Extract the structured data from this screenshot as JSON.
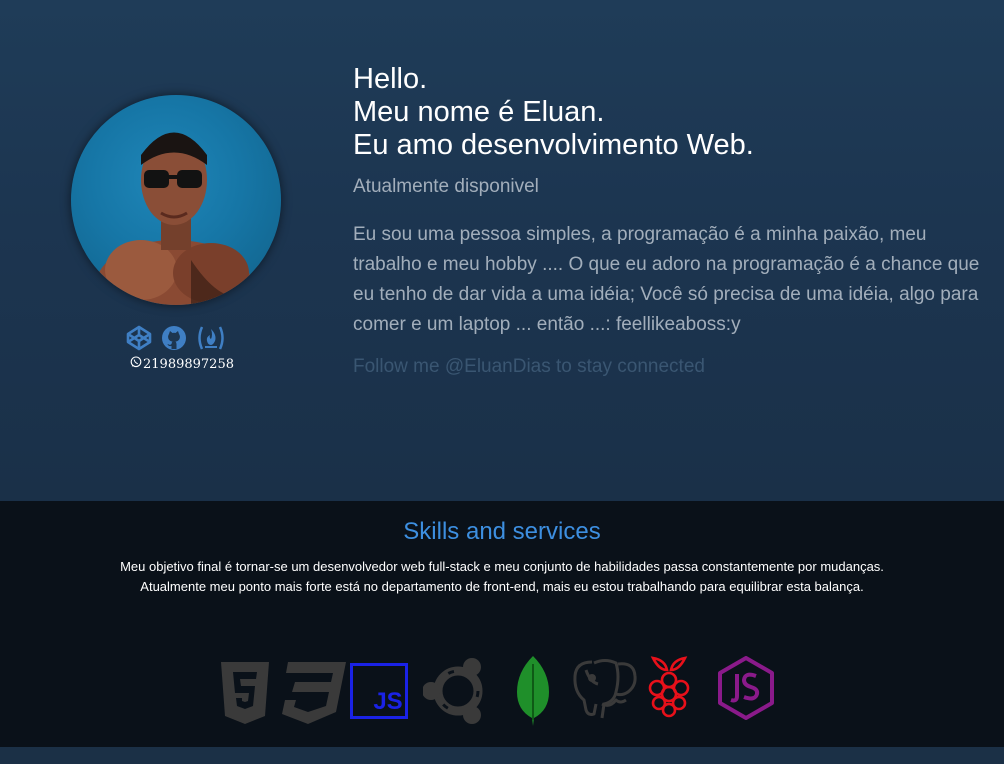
{
  "profile": {
    "avatar_alt": "profile photo",
    "phone": "21989897258",
    "social_icons": [
      "codepen-icon",
      "github-icon",
      "freecodecamp-icon"
    ],
    "whatsapp_icon": "whatsapp-icon"
  },
  "intro": {
    "line1": "Hello.",
    "line2": "Meu nome é Eluan.",
    "line3": "Eu amo desenvolvimento Web.",
    "status": "Atualmente disponivel",
    "bio": "Eu sou uma pessoa simples, a programação é a minha paixão, meu trabalho e meu hobby .... O que eu adoro na programação é a chance que eu tenho de dar vida a uma idéia; Você só precisa de uma idéia, algo para comer e um laptop ... então ...: feellikeaboss:y",
    "follow": "Follow me @EluanDias to stay connected"
  },
  "skills": {
    "title": "Skills and services",
    "description": "Meu objetivo final é tornar-se um desenvolvedor web full-stack e meu conjunto de habilidades passa constantemente por mudanças. Atualmente meu ponto mais forte está no departamento de front-end, mais eu estou trabalhando para equilibrar esta balança.",
    "icons": [
      "html5-icon",
      "css3-icon",
      "javascript-icon",
      "ubuntu-icon",
      "mongodb-icon",
      "postgresql-icon",
      "raspberry-pi-icon",
      "nodejs-icon"
    ],
    "icon_labels": {
      "js": "JS"
    }
  },
  "colors": {
    "hero_bg": "#1c3550",
    "skills_bg": "#0a1119",
    "accent_blue": "#3d8fe0",
    "social_icon": "#3f7fc4",
    "tech_grey": "#3a3a3a",
    "js_blue": "#1a22e6",
    "mongo_green": "#1f8f2a",
    "raspberry_red": "#e8101a",
    "node_purple": "#8a1a8a"
  }
}
